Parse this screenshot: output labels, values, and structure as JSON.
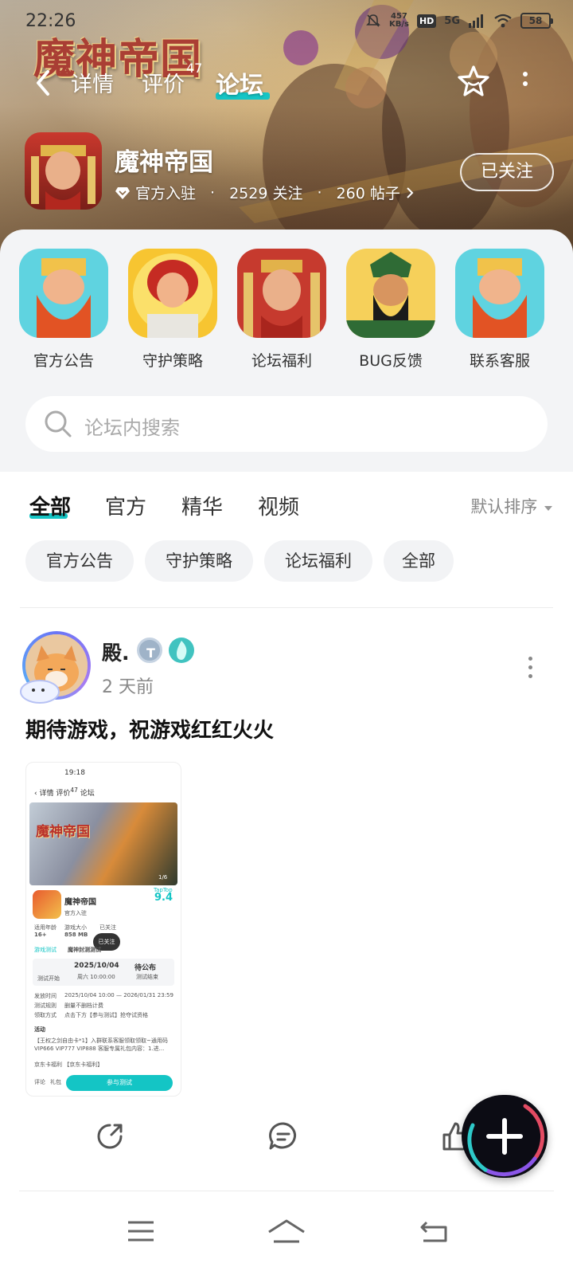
{
  "status_bar": {
    "time": "22:26",
    "speed_value": "457",
    "speed_unit": "KB/s",
    "hd": "HD",
    "network": "5G",
    "battery": "58"
  },
  "hero": {
    "logo_text": "魔神帝国"
  },
  "nav": {
    "tabs": [
      {
        "label": "详情"
      },
      {
        "label": "评价",
        "badge": "47"
      },
      {
        "label": "论坛",
        "active": true
      }
    ]
  },
  "game": {
    "title": "魔神帝国",
    "verified": "官方入驻",
    "followers": "2529 关注",
    "posts": "260 帖子",
    "follow_button": "已关注"
  },
  "shortcuts": [
    {
      "label": "官方公告"
    },
    {
      "label": "守护策略"
    },
    {
      "label": "论坛福利"
    },
    {
      "label": "BUG反馈"
    },
    {
      "label": "联系客服"
    }
  ],
  "search": {
    "placeholder": "论坛内搜索"
  },
  "filter_tabs": [
    {
      "label": "全部",
      "active": true
    },
    {
      "label": "官方"
    },
    {
      "label": "精华"
    },
    {
      "label": "视频"
    }
  ],
  "sort": {
    "label": "默认排序"
  },
  "chips": [
    {
      "label": "官方公告"
    },
    {
      "label": "守护策略"
    },
    {
      "label": "论坛福利"
    },
    {
      "label": "全部"
    }
  ],
  "post": {
    "username": "殿.",
    "time": "2 天前",
    "text": "期待游戏，祝游戏红红火火",
    "thumbnail": {
      "status_time": "19:18",
      "tab_detail": "详情",
      "tab_review": "评价",
      "review_count": "47",
      "tab_forum": "论坛",
      "banner_title": "魔神帝国",
      "banner_page": "1/6",
      "game_name": "魔神帝国",
      "official": "官方入驻",
      "score_brand": "TapTop",
      "score": "9.4",
      "age_label": "适用年龄",
      "age_value": "16+",
      "size_label": "游戏大小",
      "size_value": "858 MB",
      "followed_label": "已关注",
      "tip": "已关注",
      "event_tag": "游戏测试",
      "event_name": "魔神封测测试",
      "test_label": "测试开始",
      "date": "2025/10/04",
      "date_time": "周六 10:00:00",
      "pending": "待公布",
      "pending_sub": "测试结束",
      "line_time_label": "发放时间",
      "line_time": "2025/10/04 10:00 — 2026/01/31 23:59",
      "line_rule_label": "测试规则",
      "line_rule": "删量不删档计费",
      "line_method_label": "领取方式",
      "line_method": "点击下方【参与测试】抢夺试资格",
      "activity": "活动",
      "activity1": "【王权之剑自由卡*1】入群联系客服领取领取~通用码 VIP666 VIP777 VIP888 客服专属礼包内容：1.进...",
      "activity2": "京东卡福利 【京东卡福利】",
      "cta": "参与测试",
      "bottom1": "评论",
      "bottom2": "礼包"
    }
  },
  "colors": {
    "accent": "#14c5c5",
    "panel_bg": "#f3f4f6",
    "chip_bg": "#f2f3f5"
  }
}
